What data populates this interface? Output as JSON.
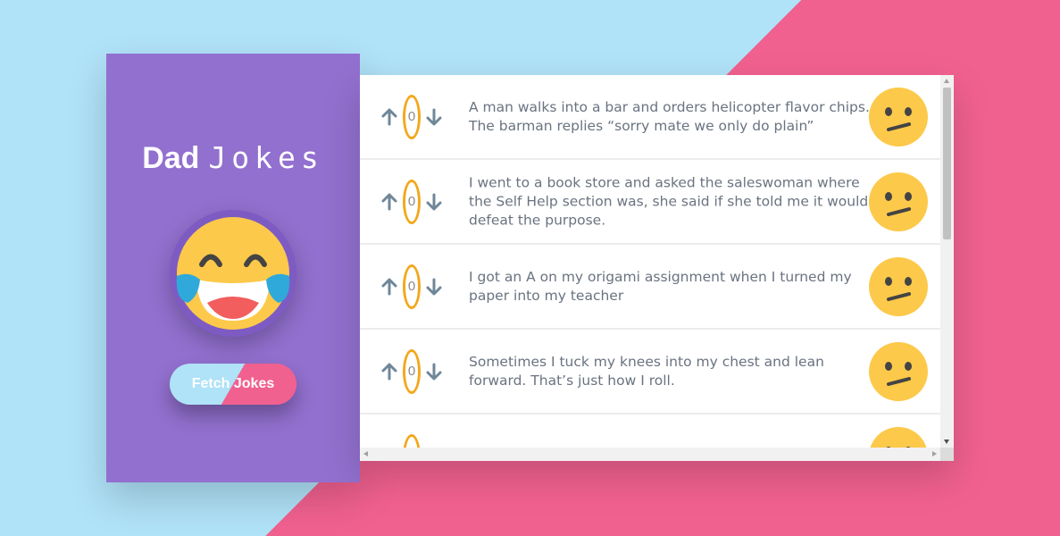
{
  "app": {
    "title_bold": "Dad",
    "title_light": "Jokes",
    "fetch_button": "Fetch Jokes"
  },
  "jokes": [
    {
      "score": "0",
      "text": "A man walks into a bar and orders helicopter flavor chips. The barman replies “sorry mate we only do plain”",
      "face": "confused-face-icon"
    },
    {
      "score": "0",
      "text": "I went to a book store and asked the saleswoman where the Self Help section was, she said if she told me it would defeat the purpose.",
      "face": "confused-face-icon"
    },
    {
      "score": "0",
      "text": "I got an A on my origami assignment when I turned my paper into my teacher",
      "face": "confused-face-icon"
    },
    {
      "score": "0",
      "text": "Sometimes I tuck my knees into my chest and lean forward. That’s just how I roll.",
      "face": "confused-face-icon"
    },
    {
      "score": "0",
      "text": "",
      "face": "confused-face-icon"
    }
  ],
  "colors": {
    "sidebar": "#9270cf",
    "bg_blue": "#b0e2f8",
    "bg_pink": "#f16190",
    "score_ring": "#f2a81d",
    "arrow": "#6f8799",
    "emoji_yellow": "#fdc94a"
  }
}
